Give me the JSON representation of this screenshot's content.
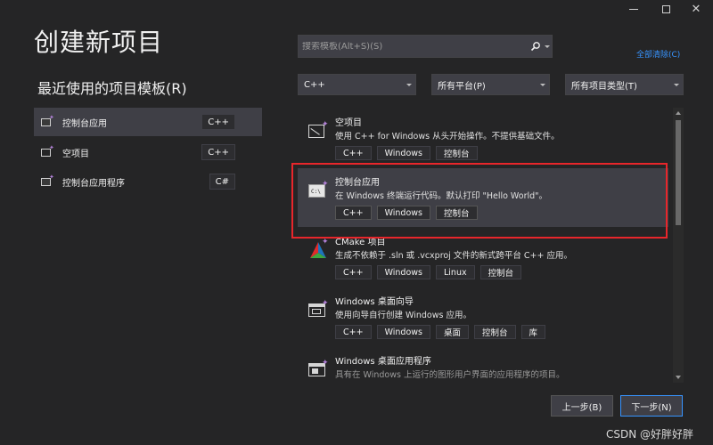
{
  "window": {
    "controls": [
      "minimize",
      "maximize",
      "close"
    ]
  },
  "page": {
    "title": "创建新项目",
    "recent_title": "最近使用的项目模板(R)"
  },
  "recent_templates": [
    {
      "label": "控制台应用",
      "lang": "C++",
      "selected": true,
      "icon": "console-app-icon"
    },
    {
      "label": "空项目",
      "lang": "C++",
      "selected": false,
      "icon": "empty-project-icon"
    },
    {
      "label": "控制台应用程序",
      "lang": "C#",
      "selected": false,
      "icon": "console-app-icon"
    }
  ],
  "search": {
    "placeholder": "搜索模板(Alt+S)(S)",
    "value": ""
  },
  "clear_all": "全部清除(C)",
  "filters": {
    "language": "C++",
    "platform": "所有平台(P)",
    "project_type": "所有项目类型(T)"
  },
  "templates": [
    {
      "name": "空项目",
      "desc": "使用 C++ for Windows 从头开始操作。不提供基础文件。",
      "tags": [
        "C++",
        "Windows",
        "控制台"
      ],
      "icon": "empty-project-icon",
      "selected": false
    },
    {
      "name": "控制台应用",
      "desc": "在 Windows 终端运行代码。默认打印 \"Hello World\"。",
      "tags": [
        "C++",
        "Windows",
        "控制台"
      ],
      "icon": "console-app-icon",
      "selected": true
    },
    {
      "name": "CMake 项目",
      "desc": "生成不依赖于 .sln 或 .vcxproj 文件的新式跨平台 C++ 应用。",
      "tags": [
        "C++",
        "Windows",
        "Linux",
        "控制台"
      ],
      "icon": "cmake-icon",
      "selected": false
    },
    {
      "name": "Windows 桌面向导",
      "desc": "使用向导自行创建 Windows 应用。",
      "tags": [
        "C++",
        "Windows",
        "桌面",
        "控制台",
        "库"
      ],
      "icon": "desktop-wizard-icon",
      "selected": false
    },
    {
      "name": "Windows 桌面应用程序",
      "desc": "具有在 Windows 上运行的图形用户界面的应用程序的项目。",
      "tags": [],
      "icon": "desktop-app-icon",
      "selected": false
    }
  ],
  "buttons": {
    "back": "上一步(B)",
    "next": "下一步(N)"
  },
  "watermark": "CSDN @好胖好胖",
  "colors": {
    "background": "#252526",
    "selected": "#3f3f46",
    "accent": "#3794ff",
    "highlight": "#e8262b"
  }
}
